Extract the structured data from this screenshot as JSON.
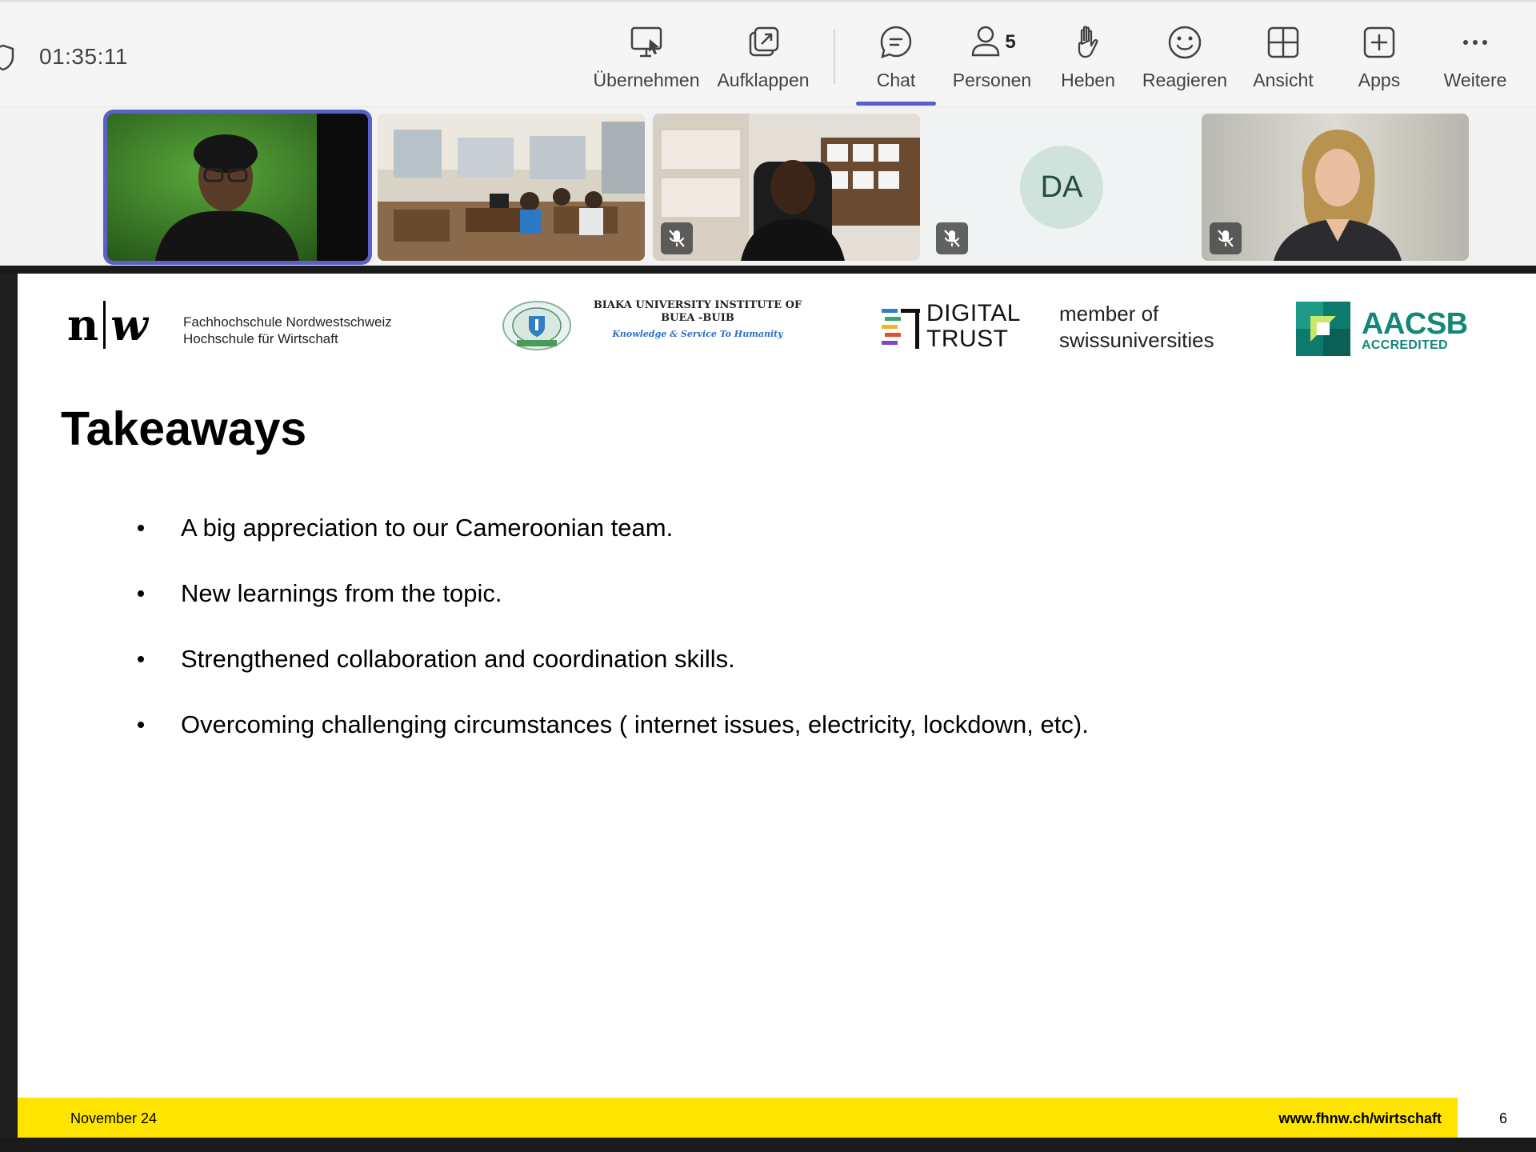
{
  "meeting": {
    "timer": "01:35:11",
    "toolbar": [
      {
        "id": "ubernehmen",
        "label": "Übernehmen",
        "icon": "take-control-icon"
      },
      {
        "id": "aufklappen",
        "label": "Aufklappen",
        "icon": "pop-out-icon"
      },
      {
        "id": "chat",
        "label": "Chat",
        "icon": "chat-icon"
      },
      {
        "id": "personen",
        "label": "Personen",
        "icon": "people-icon",
        "count": "5"
      },
      {
        "id": "heben",
        "label": "Heben",
        "icon": "raise-hand-icon"
      },
      {
        "id": "reagieren",
        "label": "Reagieren",
        "icon": "react-icon"
      },
      {
        "id": "ansicht",
        "label": "Ansicht",
        "icon": "view-icon"
      },
      {
        "id": "apps",
        "label": "Apps",
        "icon": "apps-icon"
      },
      {
        "id": "weitere",
        "label": "Weitere",
        "icon": "more-icon"
      }
    ],
    "accent_color": "#5b5fc7"
  },
  "participants": {
    "avatar_initials": "DA"
  },
  "slide": {
    "logos": {
      "fhnw_mark": "n",
      "fhnw_mark_w": "w",
      "fhnw_line1": "Fachhochschule Nordwestschweiz",
      "fhnw_line2": "Hochschule für Wirtschaft",
      "biaka_line1": "BIAKA UNIVERSITY INSTITUTE OF",
      "biaka_line2": "BUEA -BUIB",
      "biaka_motto": "Knowledge & Service To Humanity",
      "dt_line1": "DIGITAL",
      "dt_line2": "TRUST",
      "su_line1": "member of",
      "su_line2": "swissuniversities",
      "aacsb": "AACSB",
      "aacsb_sub": "ACCREDITED"
    },
    "title": "Takeaways",
    "bullets": [
      "A big appreciation to our Cameroonian team.",
      "New learnings from the topic.",
      "Strengthened collaboration and coordination skills.",
      "Overcoming challenging circumstances ( internet issues, electricity, lockdown, etc)."
    ],
    "footer": {
      "date": "November 24",
      "url": "www.fhnw.ch/wirtschaft",
      "page": "6"
    },
    "footer_color": "#ffe400"
  }
}
